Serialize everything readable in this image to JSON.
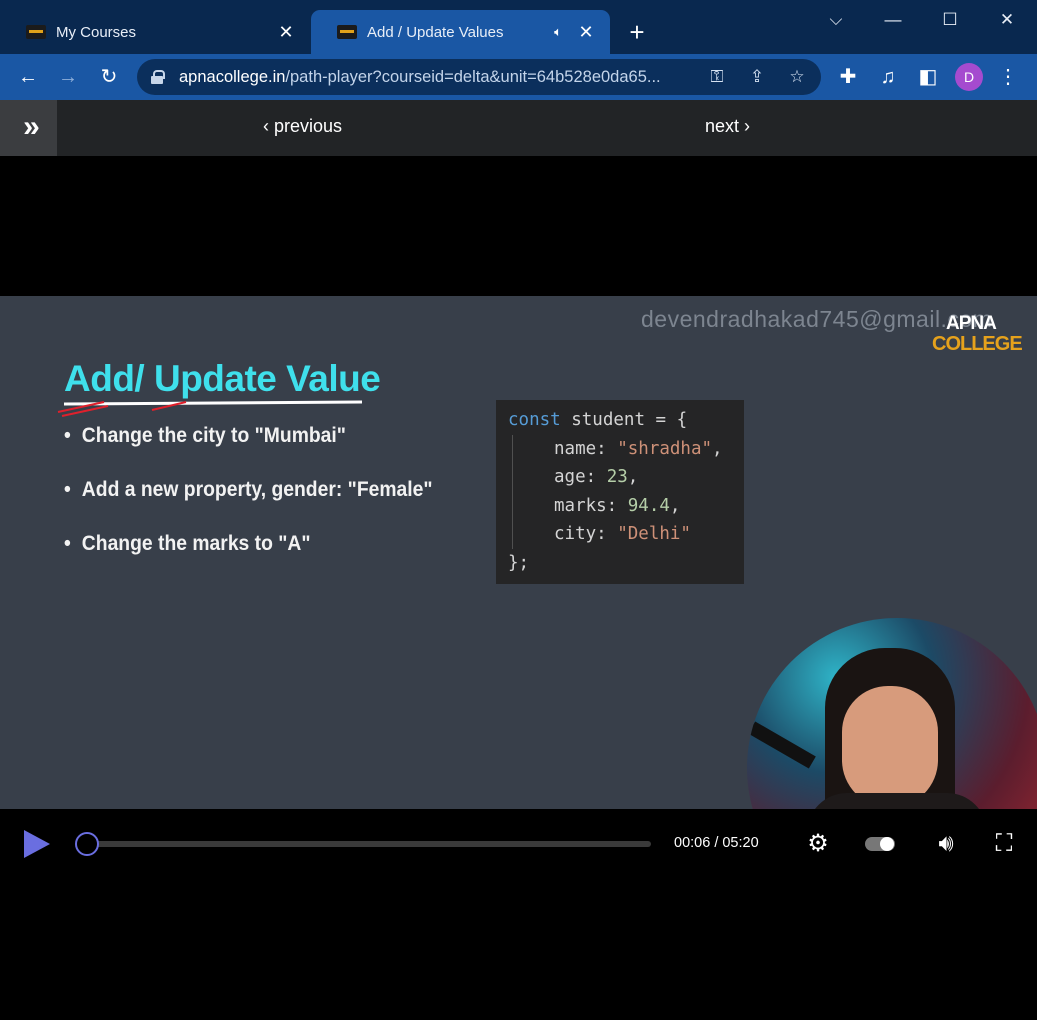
{
  "tabs": [
    {
      "title": "My Courses",
      "active": false
    },
    {
      "title": "Add / Update Values",
      "active": true
    }
  ],
  "toolbar": {
    "url_host": "apnacollege.in",
    "url_path": "/path-player?courseid=delta&unit=64b528e0da65...",
    "avatar_letter": "D"
  },
  "course_nav": {
    "previous_label": "‹ previous",
    "next_label": "next ›"
  },
  "slide": {
    "watermark": "devendradhakad745@gmail.com",
    "logo_line1": "APNA",
    "logo_line2": "COLLEGE",
    "title": "Add/ Update Value",
    "bullets": [
      "Change the city to \"Mumbai\"",
      "Add a new property, gender: \"Female\"",
      "Change the marks to \"A\""
    ],
    "code": {
      "line1_kw": "const",
      "line1_rest": " student = {",
      "name_key": "name: ",
      "name_val": "\"shradha\"",
      "age_key": "age: ",
      "age_val": "23",
      "marks_key": "marks: ",
      "marks_val": "94.4",
      "city_key": "city: ",
      "city_val": "\"Delhi\"",
      "closing": "};"
    }
  },
  "player": {
    "time_label": "00:06 / 05:20",
    "progress_fraction": 0.019
  },
  "colors": {
    "accent": "#6a6ee0",
    "tab_active": "#1a57a4",
    "tabstrip": "#09284f",
    "title_cyan": "#3fe0ec"
  }
}
